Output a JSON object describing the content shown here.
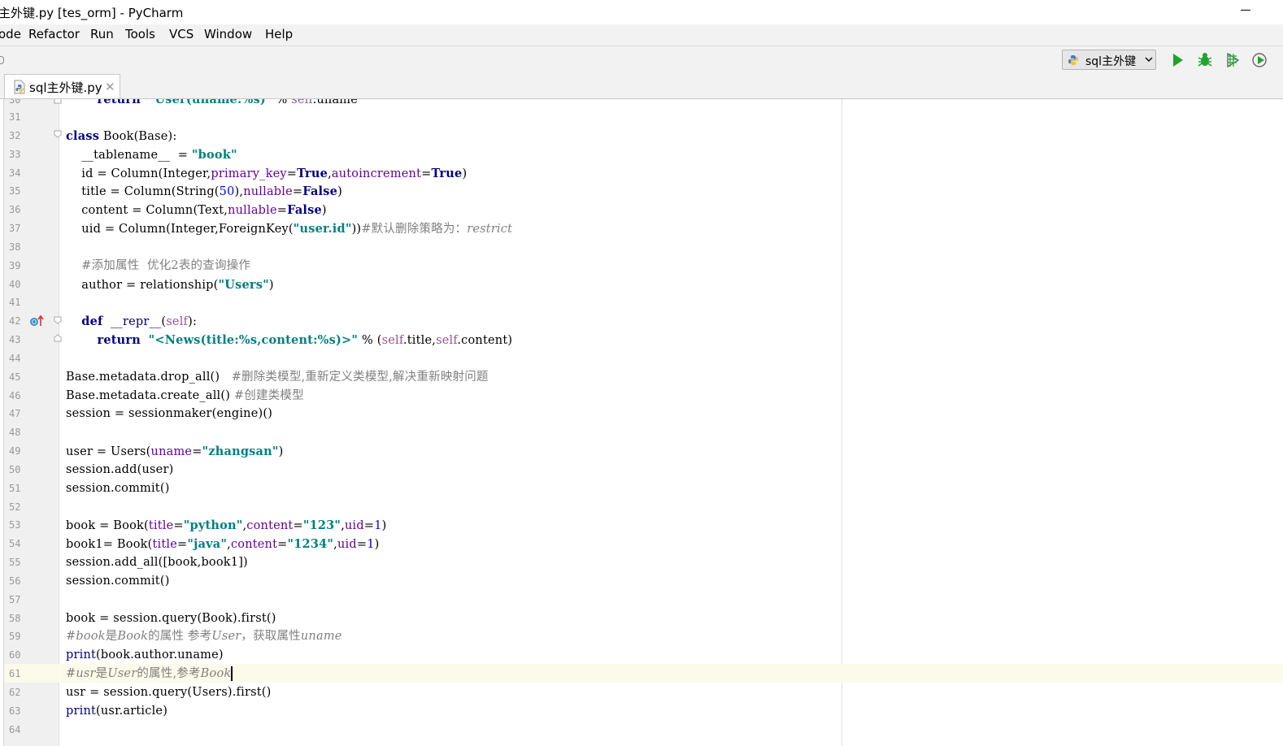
{
  "window": {
    "title": "主外键.py [tes_orm] - PyCharm"
  },
  "menubar": {
    "items": [
      "ode",
      "Refactor",
      "Run",
      "Tools",
      "VCS",
      "Window",
      "Help"
    ]
  },
  "toolbar": {
    "run_config": "sql主外键",
    "buttons": [
      "run-icon",
      "debug-icon",
      "run-with-coverage-icon",
      "profile-icon"
    ]
  },
  "tabs": [
    {
      "label": "sql主外键.py",
      "icon": "python-file-icon",
      "active": true
    }
  ],
  "editor": {
    "caret_line": 61,
    "lines": [
      {
        "n": "30",
        "text": "        return  \"User(uname:%s)\" % self.uname"
      },
      {
        "n": "31",
        "text": ""
      },
      {
        "n": "32",
        "text": "class Book(Base):"
      },
      {
        "n": "33",
        "text": "    __tablename__  = \"book\""
      },
      {
        "n": "34",
        "text": "    id = Column(Integer,primary_key=True,autoincrement=True)"
      },
      {
        "n": "35",
        "text": "    title = Column(String(50),nullable=False)"
      },
      {
        "n": "36",
        "text": "    content = Column(Text,nullable=False)"
      },
      {
        "n": "37",
        "text": "    uid = Column(Integer,ForeignKey(\"user.id\"))#默认删除策略为：restrict"
      },
      {
        "n": "38",
        "text": ""
      },
      {
        "n": "39",
        "text": "    #添加属性  优化2表的查询操作"
      },
      {
        "n": "40",
        "text": "    author = relationship(\"Users\")"
      },
      {
        "n": "41",
        "text": ""
      },
      {
        "n": "42",
        "text": "    def  __repr__(self):"
      },
      {
        "n": "43",
        "text": "        return  \"<News(title:%s,content:%s)>\" % (self.title,self.content)"
      },
      {
        "n": "44",
        "text": ""
      },
      {
        "n": "45",
        "text": "Base.metadata.drop_all()   #删除类模型,重新定义类模型,解决重新映射问题"
      },
      {
        "n": "46",
        "text": "Base.metadata.create_all() #创建类模型"
      },
      {
        "n": "47",
        "text": "session = sessionmaker(engine)()"
      },
      {
        "n": "48",
        "text": ""
      },
      {
        "n": "49",
        "text": "user = Users(uname=\"zhangsan\")"
      },
      {
        "n": "50",
        "text": "session.add(user)"
      },
      {
        "n": "51",
        "text": "session.commit()"
      },
      {
        "n": "52",
        "text": ""
      },
      {
        "n": "53",
        "text": "book = Book(title=\"python\",content=\"123\",uid=1)"
      },
      {
        "n": "54",
        "text": "book1= Book(title=\"java\",content=\"1234\",uid=1)"
      },
      {
        "n": "55",
        "text": "session.add_all([book,book1])"
      },
      {
        "n": "56",
        "text": "session.commit()"
      },
      {
        "n": "57",
        "text": ""
      },
      {
        "n": "58",
        "text": "book = session.query(Book).first()"
      },
      {
        "n": "59",
        "text": "#book是Book的属性 参考User，获取属性uname"
      },
      {
        "n": "60",
        "text": "print(book.author.uname)"
      },
      {
        "n": "61",
        "text": "#usr是User的属性,参考Book"
      },
      {
        "n": "62",
        "text": "usr = session.query(Users).first()"
      },
      {
        "n": "63",
        "text": "print(usr.article)"
      },
      {
        "n": "64",
        "text": ""
      }
    ]
  },
  "colors": {
    "keyword": "#000080",
    "string": "#008080",
    "named_param": "#660099",
    "self": "#94558d",
    "number": "#0000ff",
    "comment": "#808080",
    "caret_row": "#fcfae9",
    "run_green": "#21a32d"
  }
}
